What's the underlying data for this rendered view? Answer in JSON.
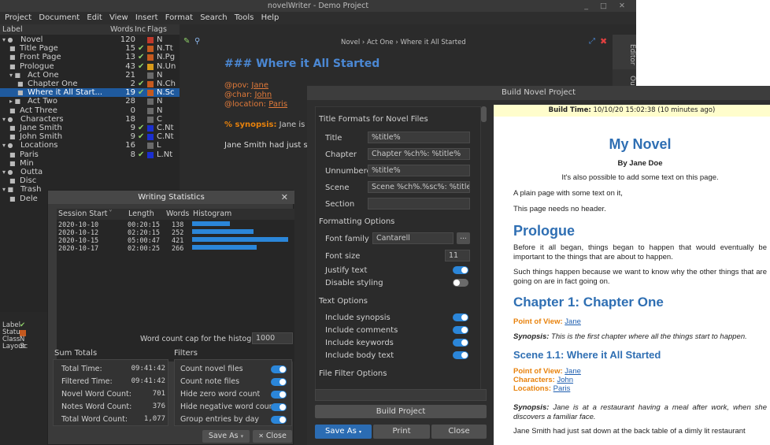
{
  "window": {
    "title": "novelWriter - Demo Project"
  },
  "menu": [
    "Project",
    "Document",
    "Edit",
    "View",
    "Insert",
    "Format",
    "Search",
    "Tools",
    "Help"
  ],
  "tree": {
    "headers": {
      "label": "Label",
      "words": "Words",
      "inc": "Inc",
      "flags": "Flags"
    },
    "rows": [
      {
        "label": "Novel",
        "words": "120",
        "check": "",
        "flag": "N",
        "color": "#c0392b",
        "icon": "▾ ●"
      },
      {
        "label": "Title Page",
        "words": "15",
        "check": "✔",
        "flag": "N.Tt",
        "color": "#c55a1f",
        "icon": "■"
      },
      {
        "label": "Front Page",
        "words": "13",
        "check": "✔",
        "flag": "N.Pg",
        "color": "#c55a1f",
        "icon": "■"
      },
      {
        "label": "Prologue",
        "words": "43",
        "check": "✔",
        "flag": "N.Un",
        "color": "#d89a1a",
        "icon": "■"
      },
      {
        "label": "Act One",
        "words": "21",
        "check": "",
        "flag": "N",
        "color": "#6a6a6a",
        "icon": "▾ ■"
      },
      {
        "label": "Chapter One",
        "words": "2",
        "check": "✔",
        "flag": "N.Ch",
        "color": "#c55a1f",
        "icon": "■"
      },
      {
        "label": "Where it All Start...",
        "words": "19",
        "check": "✔",
        "flag": "N.Sc",
        "color": "#c55a1f",
        "icon": "■",
        "sel": true
      },
      {
        "label": "Act Two",
        "words": "28",
        "check": "",
        "flag": "N",
        "color": "#6a6a6a",
        "icon": "▸ ■"
      },
      {
        "label": "Act Three",
        "words": "0",
        "check": "",
        "flag": "N",
        "color": "#6a6a6a",
        "icon": "■"
      },
      {
        "label": "Characters",
        "words": "18",
        "check": "",
        "flag": "C",
        "color": "#6a6a6a",
        "icon": "▾ ●"
      },
      {
        "label": "Jane Smith",
        "words": "9",
        "check": "✔",
        "flag": "C.Nt",
        "color": "#1a2fd0",
        "icon": "■"
      },
      {
        "label": "John Smith",
        "words": "9",
        "check": "✔",
        "flag": "C.Nt",
        "color": "#1a2fd0",
        "icon": "■"
      },
      {
        "label": "Locations",
        "words": "16",
        "check": "",
        "flag": "L",
        "color": "#6a6a6a",
        "icon": "▾ ●"
      },
      {
        "label": "Paris",
        "words": "8",
        "check": "✔",
        "flag": "L.Nt",
        "color": "#1a2fd0",
        "icon": "■"
      },
      {
        "label": "Min",
        "words": "",
        "check": "",
        "flag": "",
        "color": "",
        "icon": "■"
      },
      {
        "label": "Outta",
        "words": "",
        "check": "",
        "flag": "",
        "color": "",
        "icon": "▾ ●"
      },
      {
        "label": "Disc",
        "words": "",
        "check": "",
        "flag": "",
        "color": "",
        "icon": "■"
      },
      {
        "label": "Trash",
        "words": "",
        "check": "",
        "flag": "",
        "color": "",
        "icon": "▾ ■"
      },
      {
        "label": "Dele",
        "words": "",
        "check": "",
        "flag": "",
        "color": "",
        "icon": "■"
      }
    ],
    "footer": [
      {
        "key": "Label",
        "val": "✔"
      },
      {
        "key": "Status",
        "val": ""
      },
      {
        "key": "Class",
        "val": "N"
      },
      {
        "key": "Layout",
        "val": "Sc"
      }
    ]
  },
  "editor": {
    "crumb": "Novel › Act One › Where it All Started",
    "heading": "### Where it All Started",
    "pov_key": "@pov:",
    "pov_val": "Jane",
    "char_key": "@char:",
    "char_val": "John",
    "loc_key": "@location:",
    "loc_val": "Paris",
    "syn_key": "% synopsis:",
    "syn_val": "Jane is at a",
    "body": "Jane Smith had just sat",
    "tab_editor": "Editor",
    "tab_outline": "Out"
  },
  "stats": {
    "title": "Writing Statistics",
    "cols": {
      "start": "Session Start",
      "length": "Length",
      "words": "Words",
      "hist": "Histogram"
    },
    "rows": [
      {
        "date": "2020-10-10",
        "len": "00:20:15",
        "words": 138,
        "wlabel": "138"
      },
      {
        "date": "2020-10-12",
        "len": "02:20:15",
        "words": 252,
        "wlabel": "252"
      },
      {
        "date": "2020-10-15",
        "len": "05:00:47",
        "words": 421,
        "wlabel": "421"
      },
      {
        "date": "2020-10-17",
        "len": "02:00:25",
        "words": 266,
        "wlabel": "266"
      }
    ],
    "cap_label": "Word count cap for the histogram",
    "cap_value": "1000",
    "sum_title": "Sum Totals",
    "sums": [
      {
        "k": "Total Time:",
        "v": "09:41:42"
      },
      {
        "k": "Filtered Time:",
        "v": "09:41:42"
      },
      {
        "k": "Novel Word Count:",
        "v": "701"
      },
      {
        "k": "Notes Word Count:",
        "v": "376"
      },
      {
        "k": "Total Word Count:",
        "v": "1,077"
      }
    ],
    "filter_title": "Filters",
    "filters": [
      {
        "k": "Count novel files",
        "on": true
      },
      {
        "k": "Count note files",
        "on": true
      },
      {
        "k": "Hide zero word count",
        "on": true
      },
      {
        "k": "Hide negative word count",
        "on": true
      },
      {
        "k": "Group entries by day",
        "on": true
      }
    ],
    "save_as": "Save As",
    "close": "Close"
  },
  "build": {
    "title": "Build Novel Project",
    "title_formats_group": "Title Formats for Novel Files",
    "formats": [
      {
        "k": "Title",
        "v": "%title%"
      },
      {
        "k": "Chapter",
        "v": "Chapter %ch%: %title%"
      },
      {
        "k": "Unnumbered",
        "v": "%title%"
      },
      {
        "k": "Scene",
        "v": "Scene %ch%.%sc%: %title%"
      },
      {
        "k": "Section",
        "v": ""
      }
    ],
    "formatting_group": "Formatting Options",
    "font_family_label": "Font family",
    "font_family": "Cantarell",
    "font_more": "...",
    "font_size_label": "Font size",
    "font_size": "11",
    "justify_label": "Justify text",
    "justify_on": true,
    "disable_label": "Disable styling",
    "disable_on": false,
    "text_group": "Text Options",
    "text_opts": [
      {
        "k": "Include synopsis",
        "on": true
      },
      {
        "k": "Include comments",
        "on": true
      },
      {
        "k": "Include keywords",
        "on": true
      },
      {
        "k": "Include body text",
        "on": true
      }
    ],
    "filter_group": "File Filter Options",
    "build_btn": "Build Project",
    "save_as": "Save As",
    "print": "Print",
    "close": "Close"
  },
  "preview": {
    "build_time_label": "Build Time:",
    "build_time": "10/10/20 15:02:38 (10 minutes ago)",
    "novel_title": "My Novel",
    "author": "By Jane Doe",
    "p1": "It's also possible to add some text on this page.",
    "p2": "A plain page with some text on it,",
    "p3": "This page needs no header.",
    "h_prologue": "Prologue",
    "p4": "Before it all began, things began to happen that would eventually be important to the things that are about to happen.",
    "p5": "Such things happen because we want to know why the other things that are going on are in fact going on.",
    "h_ch1": "Chapter 1: Chapter One",
    "pov_label": "Point of View:",
    "pov": "Jane",
    "syn_label": "Synopsis:",
    "syn1": "This is the first chapter where all the things start to happen.",
    "h_sc": "Scene 1.1: Where it All Started",
    "pov2": "Jane",
    "char_label": "Characters:",
    "char": "John",
    "loc_label": "Locations:",
    "loc": "Paris",
    "syn2": "Jane is at a restaurant having a meal after work, when she discovers a familiar face.",
    "p6": "Jane Smith had just sat down at the back table of a dimly lit restaurant"
  },
  "colors": {
    "accent": "#2b86d9",
    "heading": "#4b88d4",
    "keyword": "#e8820c"
  }
}
